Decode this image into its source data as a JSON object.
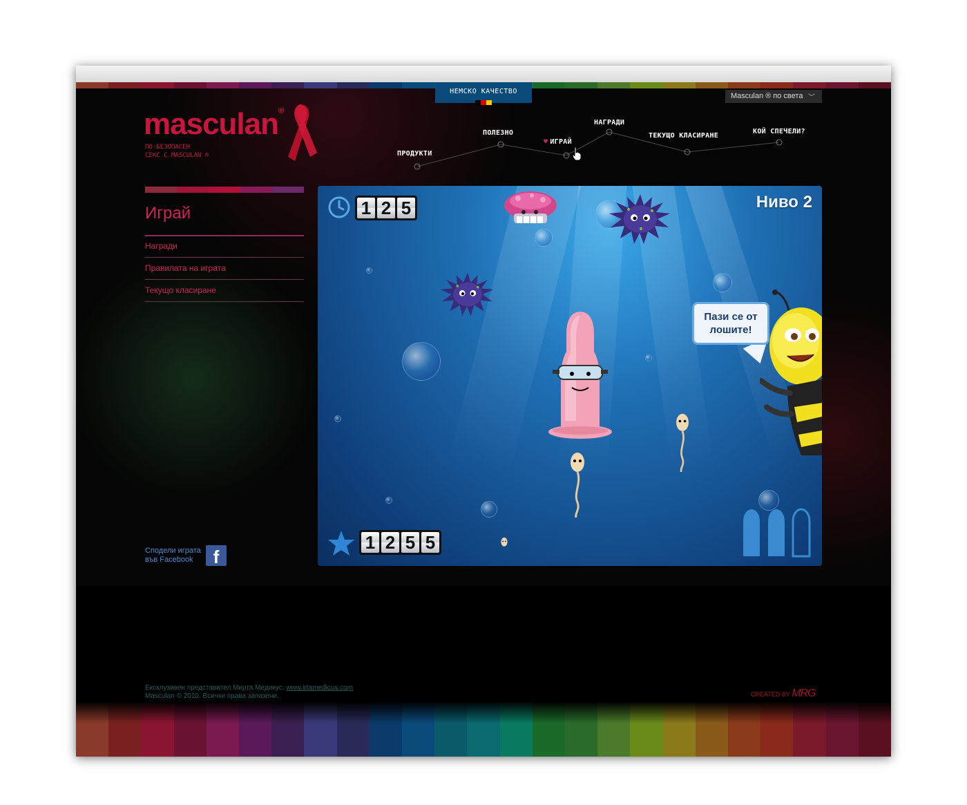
{
  "header": {
    "quality_label": "НЕМСКО КАЧЕСТВО",
    "lang_selector": "Masculan ® по света",
    "logo_text": "masculan",
    "logo_reg": "®",
    "tagline_line1": "ПО-БЕЗОПАСЕН",
    "tagline_line2": "СЕКС С MASCULAN ®"
  },
  "nav": {
    "items": [
      {
        "label": "ПРОДУКТИ"
      },
      {
        "label": "ПОЛЕЗНО"
      },
      {
        "label": "ИГРАЙ"
      },
      {
        "label": "НАГРАДИ"
      },
      {
        "label": "ТЕКУЩО КЛАСИРАНЕ"
      },
      {
        "label": "КОЙ СПЕЧЕЛИ?"
      }
    ]
  },
  "sidebar": {
    "title": "Играй",
    "links": [
      {
        "label": "Награди"
      },
      {
        "label": "Правилата на играта"
      },
      {
        "label": "Текущо класиране"
      }
    ],
    "share_line1": "Сподели играта",
    "share_line2": "във Facebook",
    "fb_letter": "f"
  },
  "game": {
    "timer_digits": [
      "1",
      "2",
      "5"
    ],
    "score_digits": [
      "1",
      "2",
      "5",
      "5"
    ],
    "level_label": "Ниво",
    "level_value": "2",
    "speech_line1": "Пази се от",
    "speech_line2": "лошите!",
    "lives_total": 3,
    "lives_active": 2
  },
  "footer": {
    "line1_text": "Ексклузивен представител Мирта Медикус.",
    "line1_link": "www.irtamedicus.com",
    "line2_text": "Masculan © 2010. Всички права запазени.",
    "created_by": "CREATED BY",
    "created_logo": "MRG"
  },
  "colors": {
    "brand_red": "#c8163f",
    "link_pink": "#d0225a",
    "stripes": [
      "#8a3a2a",
      "#7a2020",
      "#8a1530",
      "#6a1232",
      "#7a1a50",
      "#5a1a5a",
      "#3a2050",
      "#3a3a7a",
      "#2a2a5a",
      "#0a3a6a",
      "#0a4a7a",
      "#0a5a6a",
      "#0a6a70",
      "#0a7a60",
      "#1a6a2a",
      "#2a6a2a",
      "#4a7a2a",
      "#6a8a1a",
      "#8a7a1a",
      "#8a5a1a",
      "#8a3a1a",
      "#8a2a1a",
      "#7a1a2a",
      "#6a1530",
      "#5a1020"
    ]
  }
}
